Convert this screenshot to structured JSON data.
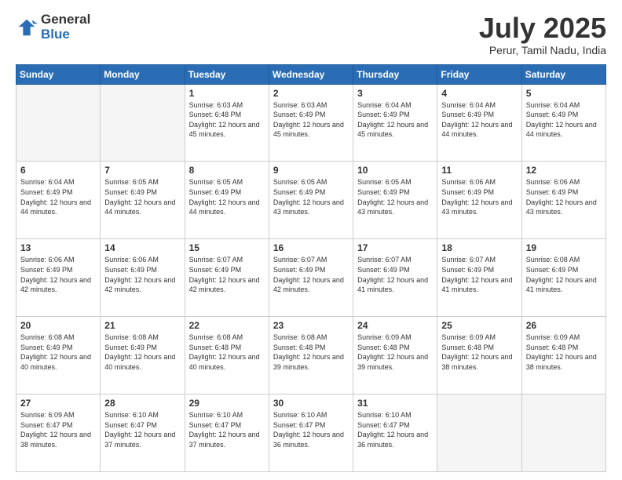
{
  "logo": {
    "general": "General",
    "blue": "Blue"
  },
  "header": {
    "month_title": "July 2025",
    "subtitle": "Perur, Tamil Nadu, India"
  },
  "weekdays": [
    "Sunday",
    "Monday",
    "Tuesday",
    "Wednesday",
    "Thursday",
    "Friday",
    "Saturday"
  ],
  "weeks": [
    [
      {
        "day": "",
        "empty": true
      },
      {
        "day": "",
        "empty": true
      },
      {
        "day": "1",
        "sunrise": "Sunrise: 6:03 AM",
        "sunset": "Sunset: 6:48 PM",
        "daylight": "Daylight: 12 hours and 45 minutes."
      },
      {
        "day": "2",
        "sunrise": "Sunrise: 6:03 AM",
        "sunset": "Sunset: 6:49 PM",
        "daylight": "Daylight: 12 hours and 45 minutes."
      },
      {
        "day": "3",
        "sunrise": "Sunrise: 6:04 AM",
        "sunset": "Sunset: 6:49 PM",
        "daylight": "Daylight: 12 hours and 45 minutes."
      },
      {
        "day": "4",
        "sunrise": "Sunrise: 6:04 AM",
        "sunset": "Sunset: 6:49 PM",
        "daylight": "Daylight: 12 hours and 44 minutes."
      },
      {
        "day": "5",
        "sunrise": "Sunrise: 6:04 AM",
        "sunset": "Sunset: 6:49 PM",
        "daylight": "Daylight: 12 hours and 44 minutes."
      }
    ],
    [
      {
        "day": "6",
        "sunrise": "Sunrise: 6:04 AM",
        "sunset": "Sunset: 6:49 PM",
        "daylight": "Daylight: 12 hours and 44 minutes."
      },
      {
        "day": "7",
        "sunrise": "Sunrise: 6:05 AM",
        "sunset": "Sunset: 6:49 PM",
        "daylight": "Daylight: 12 hours and 44 minutes."
      },
      {
        "day": "8",
        "sunrise": "Sunrise: 6:05 AM",
        "sunset": "Sunset: 6:49 PM",
        "daylight": "Daylight: 12 hours and 44 minutes."
      },
      {
        "day": "9",
        "sunrise": "Sunrise: 6:05 AM",
        "sunset": "Sunset: 6:49 PM",
        "daylight": "Daylight: 12 hours and 43 minutes."
      },
      {
        "day": "10",
        "sunrise": "Sunrise: 6:05 AM",
        "sunset": "Sunset: 6:49 PM",
        "daylight": "Daylight: 12 hours and 43 minutes."
      },
      {
        "day": "11",
        "sunrise": "Sunrise: 6:06 AM",
        "sunset": "Sunset: 6:49 PM",
        "daylight": "Daylight: 12 hours and 43 minutes."
      },
      {
        "day": "12",
        "sunrise": "Sunrise: 6:06 AM",
        "sunset": "Sunset: 6:49 PM",
        "daylight": "Daylight: 12 hours and 43 minutes."
      }
    ],
    [
      {
        "day": "13",
        "sunrise": "Sunrise: 6:06 AM",
        "sunset": "Sunset: 6:49 PM",
        "daylight": "Daylight: 12 hours and 42 minutes."
      },
      {
        "day": "14",
        "sunrise": "Sunrise: 6:06 AM",
        "sunset": "Sunset: 6:49 PM",
        "daylight": "Daylight: 12 hours and 42 minutes."
      },
      {
        "day": "15",
        "sunrise": "Sunrise: 6:07 AM",
        "sunset": "Sunset: 6:49 PM",
        "daylight": "Daylight: 12 hours and 42 minutes."
      },
      {
        "day": "16",
        "sunrise": "Sunrise: 6:07 AM",
        "sunset": "Sunset: 6:49 PM",
        "daylight": "Daylight: 12 hours and 42 minutes."
      },
      {
        "day": "17",
        "sunrise": "Sunrise: 6:07 AM",
        "sunset": "Sunset: 6:49 PM",
        "daylight": "Daylight: 12 hours and 41 minutes."
      },
      {
        "day": "18",
        "sunrise": "Sunrise: 6:07 AM",
        "sunset": "Sunset: 6:49 PM",
        "daylight": "Daylight: 12 hours and 41 minutes."
      },
      {
        "day": "19",
        "sunrise": "Sunrise: 6:08 AM",
        "sunset": "Sunset: 6:49 PM",
        "daylight": "Daylight: 12 hours and 41 minutes."
      }
    ],
    [
      {
        "day": "20",
        "sunrise": "Sunrise: 6:08 AM",
        "sunset": "Sunset: 6:49 PM",
        "daylight": "Daylight: 12 hours and 40 minutes."
      },
      {
        "day": "21",
        "sunrise": "Sunrise: 6:08 AM",
        "sunset": "Sunset: 6:49 PM",
        "daylight": "Daylight: 12 hours and 40 minutes."
      },
      {
        "day": "22",
        "sunrise": "Sunrise: 6:08 AM",
        "sunset": "Sunset: 6:48 PM",
        "daylight": "Daylight: 12 hours and 40 minutes."
      },
      {
        "day": "23",
        "sunrise": "Sunrise: 6:08 AM",
        "sunset": "Sunset: 6:48 PM",
        "daylight": "Daylight: 12 hours and 39 minutes."
      },
      {
        "day": "24",
        "sunrise": "Sunrise: 6:09 AM",
        "sunset": "Sunset: 6:48 PM",
        "daylight": "Daylight: 12 hours and 39 minutes."
      },
      {
        "day": "25",
        "sunrise": "Sunrise: 6:09 AM",
        "sunset": "Sunset: 6:48 PM",
        "daylight": "Daylight: 12 hours and 38 minutes."
      },
      {
        "day": "26",
        "sunrise": "Sunrise: 6:09 AM",
        "sunset": "Sunset: 6:48 PM",
        "daylight": "Daylight: 12 hours and 38 minutes."
      }
    ],
    [
      {
        "day": "27",
        "sunrise": "Sunrise: 6:09 AM",
        "sunset": "Sunset: 6:47 PM",
        "daylight": "Daylight: 12 hours and 38 minutes."
      },
      {
        "day": "28",
        "sunrise": "Sunrise: 6:10 AM",
        "sunset": "Sunset: 6:47 PM",
        "daylight": "Daylight: 12 hours and 37 minutes."
      },
      {
        "day": "29",
        "sunrise": "Sunrise: 6:10 AM",
        "sunset": "Sunset: 6:47 PM",
        "daylight": "Daylight: 12 hours and 37 minutes."
      },
      {
        "day": "30",
        "sunrise": "Sunrise: 6:10 AM",
        "sunset": "Sunset: 6:47 PM",
        "daylight": "Daylight: 12 hours and 36 minutes."
      },
      {
        "day": "31",
        "sunrise": "Sunrise: 6:10 AM",
        "sunset": "Sunset: 6:47 PM",
        "daylight": "Daylight: 12 hours and 36 minutes."
      },
      {
        "day": "",
        "empty": true
      },
      {
        "day": "",
        "empty": true
      }
    ]
  ]
}
